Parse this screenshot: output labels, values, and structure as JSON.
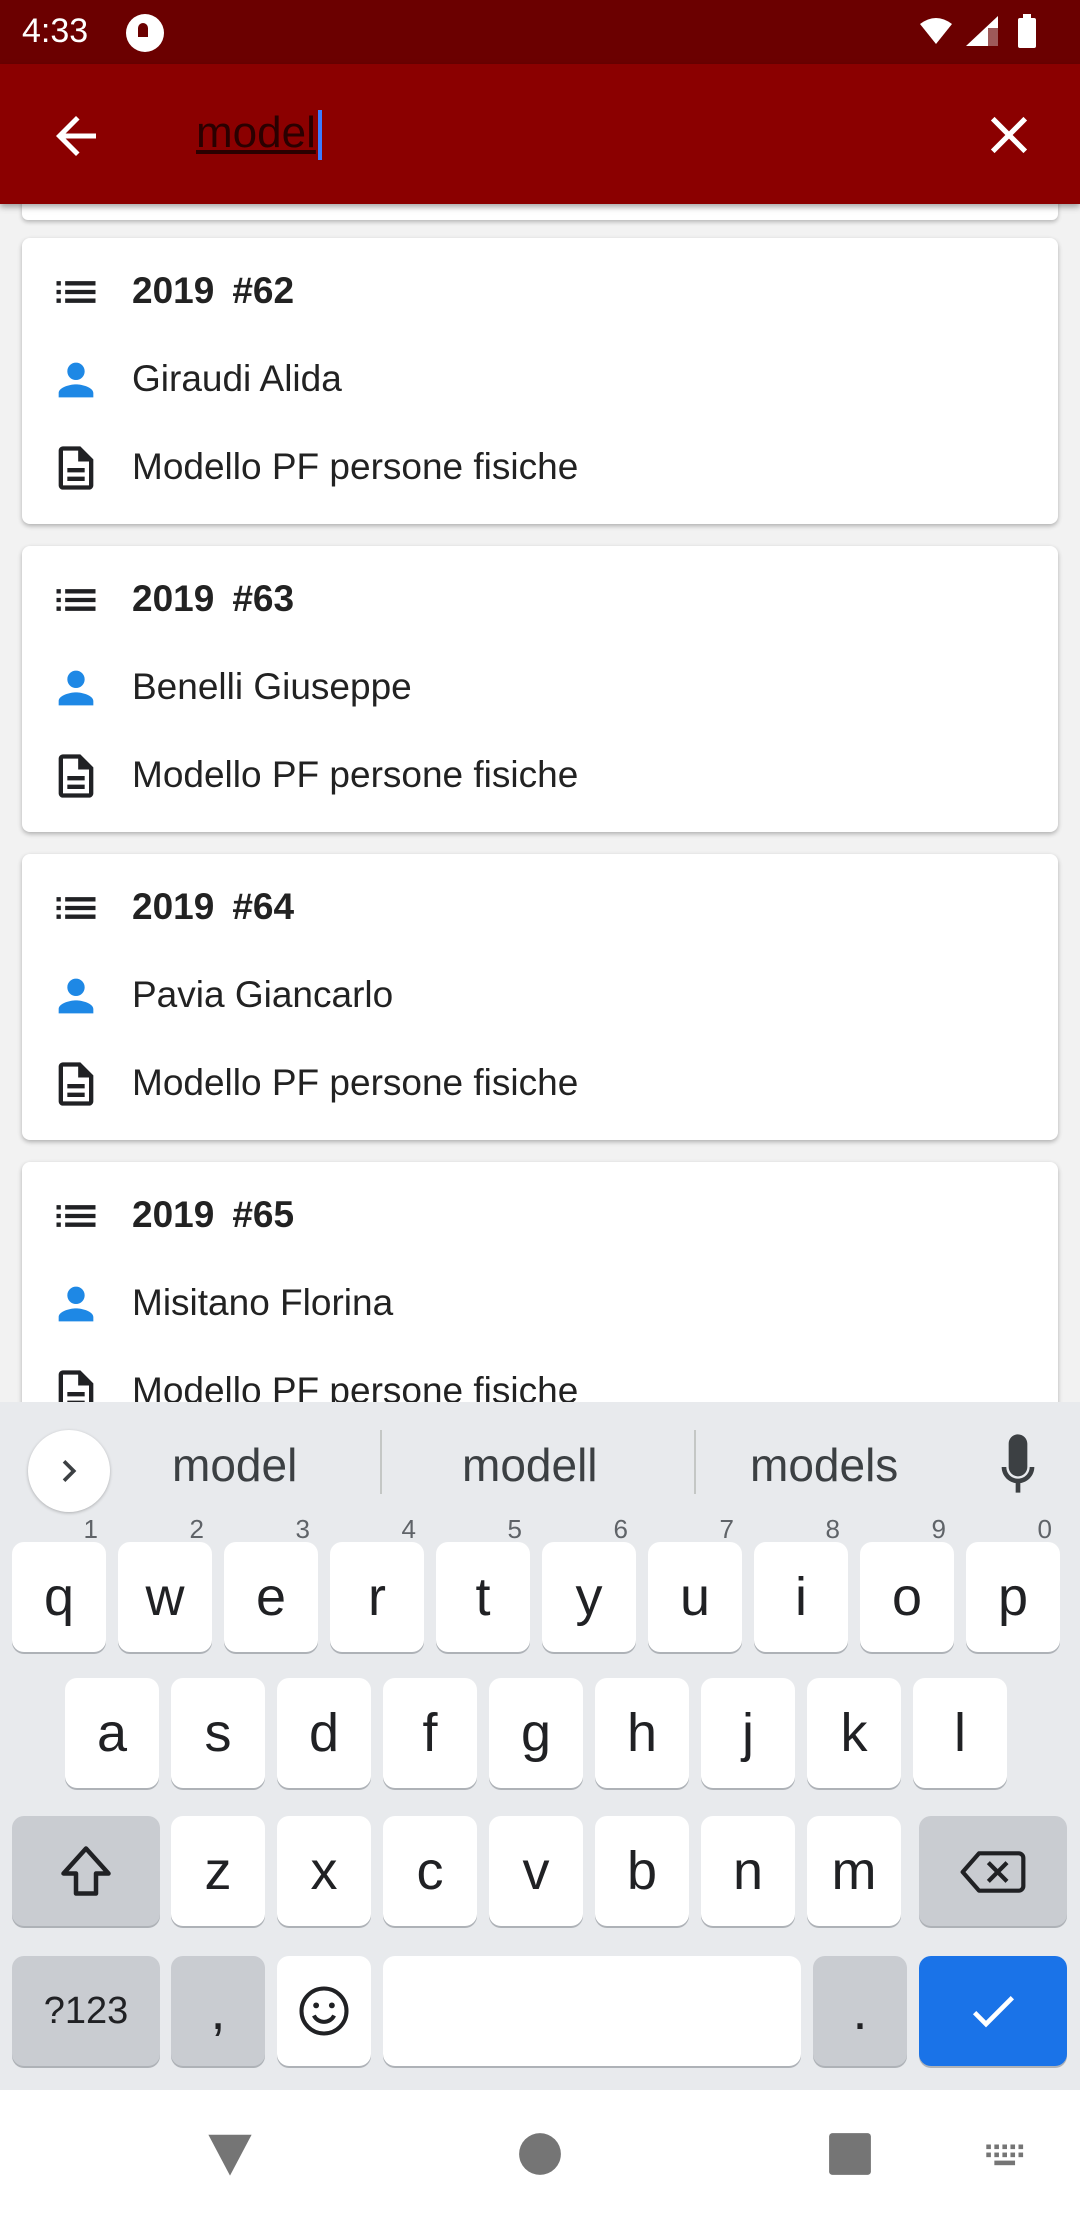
{
  "status_bar": {
    "time": "4:33"
  },
  "search": {
    "query": "model"
  },
  "results": [
    {
      "year": "2019",
      "number": "#62",
      "person": "Giraudi Alida",
      "document": "Modello PF persone fisiche"
    },
    {
      "year": "2019",
      "number": "#63",
      "person": "Benelli Giuseppe",
      "document": "Modello PF persone fisiche"
    },
    {
      "year": "2019",
      "number": "#64",
      "person": "Pavia Giancarlo",
      "document": "Modello PF persone fisiche"
    },
    {
      "year": "2019",
      "number": "#65",
      "person": "Misitano Florina",
      "document": "Modello PF persone fisiche"
    }
  ],
  "keyboard": {
    "suggestions": [
      "model",
      "modell",
      "models"
    ],
    "row1": [
      "q",
      "w",
      "e",
      "r",
      "t",
      "y",
      "u",
      "i",
      "o",
      "p"
    ],
    "row1_hints": [
      "1",
      "2",
      "3",
      "4",
      "5",
      "6",
      "7",
      "8",
      "9",
      "0"
    ],
    "row2": [
      "a",
      "s",
      "d",
      "f",
      "g",
      "h",
      "j",
      "k",
      "l"
    ],
    "row3": [
      "z",
      "x",
      "c",
      "v",
      "b",
      "n",
      "m"
    ],
    "symbols_label": "?123",
    "comma": ",",
    "period": "."
  },
  "colors": {
    "status_bar": "#6b0000",
    "app_bar": "#8b0000",
    "person_icon": "#1e88e5",
    "action_key": "#1a73e8"
  },
  "icons": {
    "back": "arrow-left-icon",
    "clear": "close-icon",
    "list": "list-icon",
    "person": "person-icon",
    "document": "document-icon",
    "mic": "mic-icon"
  }
}
